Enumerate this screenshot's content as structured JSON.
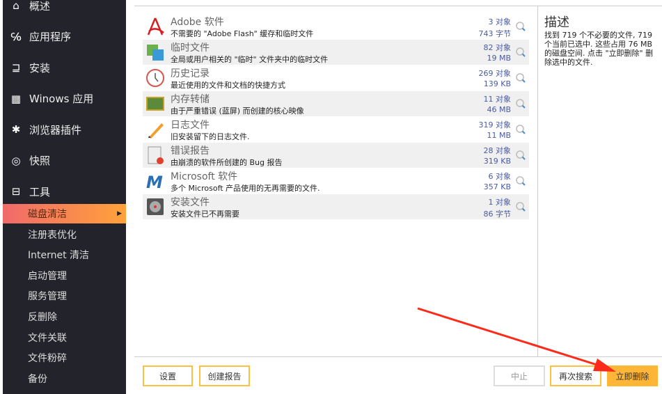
{
  "sidebar": {
    "main": [
      {
        "label": "概述",
        "icon": "home-icon"
      },
      {
        "label": "应用程序",
        "icon": "apps-icon"
      },
      {
        "label": "安装",
        "icon": "install-icon"
      },
      {
        "label": "Winows 应用",
        "icon": "windows-icon"
      },
      {
        "label": "浏览器插件",
        "icon": "puzzle-icon"
      },
      {
        "label": "快照",
        "icon": "snapshot-icon"
      },
      {
        "label": "工具",
        "icon": "toolbox-icon"
      }
    ],
    "tools": [
      "磁盘清洁",
      "注册表优化",
      "Internet 清洁",
      "启动管理",
      "服务管理",
      "反删除",
      "文件关联",
      "文件粉碎",
      "备份"
    ]
  },
  "items": [
    {
      "title": "Adobe 软件",
      "desc": "不需要的 \"Adobe Flash\" 缓存和临时文件",
      "count": "3 对象",
      "size": "743 字节"
    },
    {
      "title": "临时文件",
      "desc": "全局或用户相关的 \"临时\" 文件夹中的临时文件",
      "count": "82 对象",
      "size": "19 MB"
    },
    {
      "title": "历史记录",
      "desc": "最近使用的文件和文档的快捷方式",
      "count": "269 对象",
      "size": "139 KB"
    },
    {
      "title": "内存转储",
      "desc": "由于严重错误 (蓝屏) 而创建的核心映像",
      "count": "11 对象",
      "size": "46 MB"
    },
    {
      "title": "日志文件",
      "desc": "旧安装留下的日志文件.",
      "count": "319 对象",
      "size": "11 MB"
    },
    {
      "title": "错误报告",
      "desc": "由崩溃的软件所创建的 Bug 报告",
      "count": "28 对象",
      "size": "319 KB"
    },
    {
      "title": "Microsoft 软件",
      "desc": "多个 Microsoft 产品使用的无再需要的文件.",
      "count": "6 对象",
      "size": "357 KB"
    },
    {
      "title": "安装文件",
      "desc": "安装文件已不再需要",
      "count": "1 对象",
      "size": "86 字节"
    }
  ],
  "description": {
    "title": "描述",
    "text": "找到 719 个不必要的文件, 719 个当前已选中. 这些占用 76 MB 的磁盘空间. 点击 \"立即删除\" 删除选中的文件."
  },
  "buttons": {
    "settings": "设置",
    "report": "创建报告",
    "stop": "中止",
    "rescan": "再次搜索",
    "delete": "立即删除"
  },
  "colors": {
    "accent": "#ffb535",
    "sidebar": "#23232b",
    "arrow": "#ff2a1a"
  }
}
